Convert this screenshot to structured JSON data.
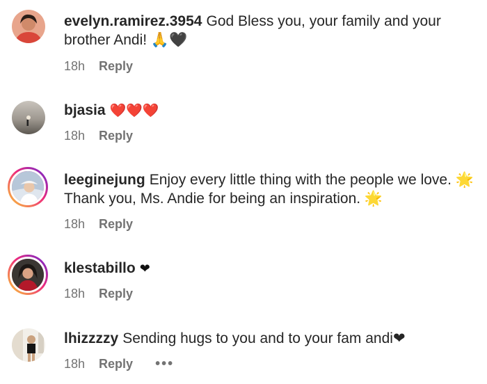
{
  "comments": [
    {
      "username": "evelyn.ramirez.3954",
      "text": "God Bless you, your family and your brother Andi! 🙏🖤",
      "time": "18h",
      "reply": "Reply"
    },
    {
      "username": "bjasia",
      "text": "❤️❤️❤️",
      "time": "18h",
      "reply": "Reply"
    },
    {
      "username": "leeginejung",
      "text": "Enjoy every little thing with the people we love. 🌟 Thank you, Ms. Andie for being an inspiration. 🌟",
      "time": "18h",
      "reply": "Reply"
    },
    {
      "username": "klestabillo",
      "text": "❤",
      "time": "18h",
      "reply": "Reply"
    },
    {
      "username": "lhizzzzy",
      "text": "Sending hugs to you and to your fam andi❤",
      "time": "18h",
      "reply": "Reply",
      "more": "•••"
    }
  ],
  "icons": {
    "more": "ellipsis-icon"
  }
}
